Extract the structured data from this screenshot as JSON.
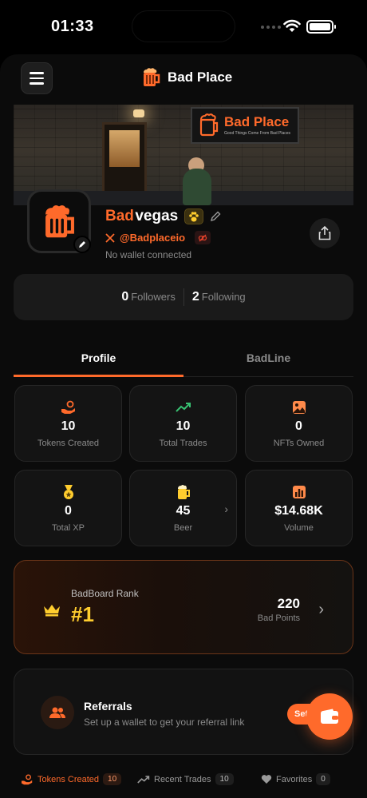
{
  "status_bar": {
    "time": "01:33"
  },
  "header": {
    "brand_name": "Bad Place"
  },
  "banner": {
    "sign_title": "Bad Place",
    "sign_tagline": "Good Things Come From Bad Places"
  },
  "profile": {
    "name_first": "Bad",
    "name_last": "vegas",
    "handle": "@Badplaceio",
    "wallet_status": "No wallet connected"
  },
  "follow": {
    "followers_count": "0",
    "followers_label": "Followers",
    "following_count": "2",
    "following_label": "Following"
  },
  "tabs": {
    "profile": "Profile",
    "badline": "BadLine",
    "active": "Profile"
  },
  "stats": [
    {
      "icon": "hand-coin-icon",
      "value": "10",
      "label": "Tokens Created"
    },
    {
      "icon": "trending-up-icon",
      "value": "10",
      "label": "Total Trades"
    },
    {
      "icon": "image-icon",
      "value": "0",
      "label": "NFTs Owned"
    },
    {
      "icon": "medal-icon",
      "value": "0",
      "label": "Total XP"
    },
    {
      "icon": "beer-icon",
      "value": "45",
      "label": "Beer"
    },
    {
      "icon": "bar-chart-icon",
      "value": "$14.68K",
      "label": "Volume"
    }
  ],
  "rank": {
    "label": "BadBoard Rank",
    "value": "#1",
    "points": "220",
    "points_label": "Bad Points"
  },
  "referrals": {
    "title": "Referrals",
    "subtitle": "Set up a wallet to get your referral link",
    "button_label": "Set up"
  },
  "bottom_tabs": [
    {
      "label": "Tokens Created",
      "count": "10",
      "active": true
    },
    {
      "label": "Recent Trades",
      "count": "10",
      "active": false
    },
    {
      "label": "Favorites",
      "count": "0",
      "active": false
    }
  ],
  "colors": {
    "accent": "#ff6a2b",
    "rank_gold": "#ffcd2e",
    "stat_green": "#38c172"
  }
}
